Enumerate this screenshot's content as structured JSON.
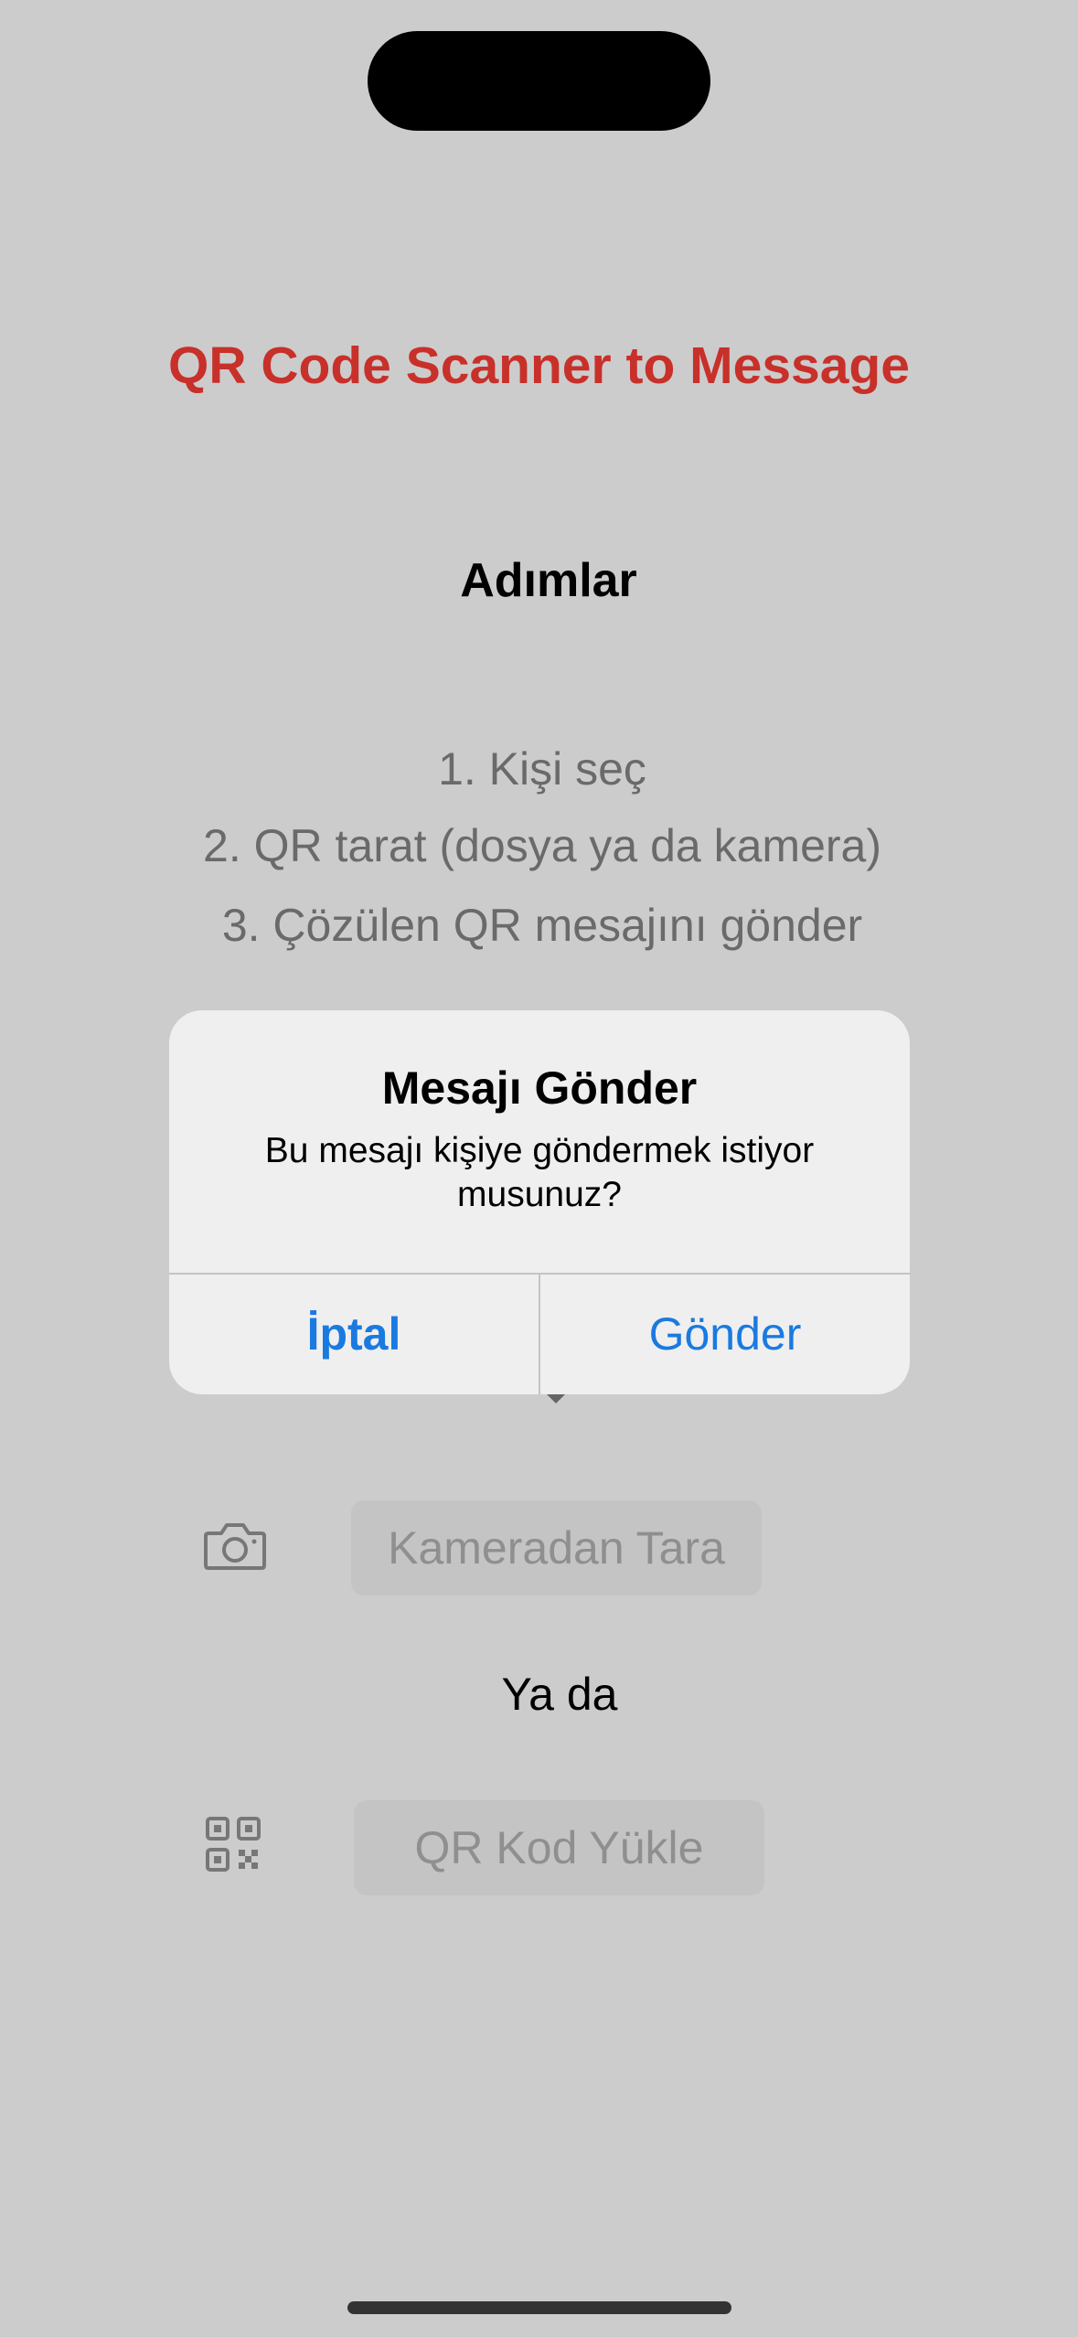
{
  "app": {
    "title": "QR Code Scanner to Message"
  },
  "steps": {
    "heading": "Adımlar",
    "items": [
      "1. Kişi seç",
      "2. QR tarat (dosya ya da kamera)",
      "3. Çözülen QR mesajını gönder"
    ]
  },
  "alert": {
    "title": "Mesajı Gönder",
    "message": "Bu mesajı kişiye göndermek istiyor musunuz?",
    "cancel_label": "İptal",
    "send_label": "Gönder"
  },
  "actions": {
    "camera_label": "Kameradan Tara",
    "camera_icon": "camera-icon",
    "or_label": "Ya da",
    "qr_label": "QR Kod Yükle",
    "qr_icon": "qr-code-icon"
  },
  "colors": {
    "title": "#c8302a",
    "accent": "#1a7ae0",
    "background": "#cccccc"
  }
}
